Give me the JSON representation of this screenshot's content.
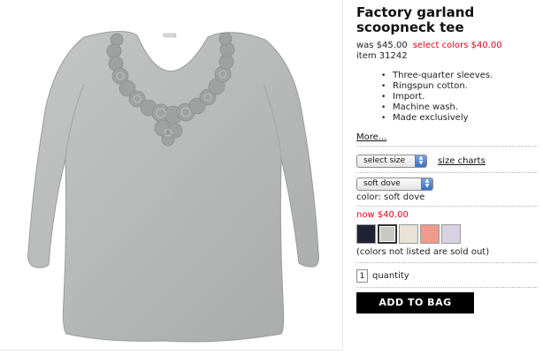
{
  "product": {
    "title": "Factory garland scoopneck tee",
    "was_price": "was $45.00",
    "sale_price": "select colors $40.00",
    "item_number": "item 31242",
    "image_icon": "gray-garland-tee-image"
  },
  "features": [
    "Three-quarter sleeves.",
    "Ringspun cotton.",
    "Import.",
    "Machine wash.",
    "Made exclusively"
  ],
  "more_link": "More...",
  "size": {
    "select_label": "select size",
    "charts_link": "size charts"
  },
  "color": {
    "select_value": "soft dove",
    "label": "color: soft dove"
  },
  "now_price": "now $40.00",
  "swatches": [
    {
      "name": "navy",
      "color": "#1f2333",
      "selected": false
    },
    {
      "name": "soft dove",
      "color": "#c9c8c2",
      "selected": true
    },
    {
      "name": "ivory",
      "color": "#e8e3d7",
      "selected": false
    },
    {
      "name": "coral",
      "color": "#ef9a8a",
      "selected": false
    },
    {
      "name": "lavender",
      "color": "#d9d2e2",
      "selected": false
    }
  ],
  "sold_out_note": "(colors not listed are sold out)",
  "quantity": {
    "value": "1",
    "label": "quantity"
  },
  "add_to_bag_label": "ADD TO BAG",
  "colors": {
    "sale_red": "#e2001a",
    "button_black": "#000000",
    "tee_gray": "#b4b6b6"
  }
}
